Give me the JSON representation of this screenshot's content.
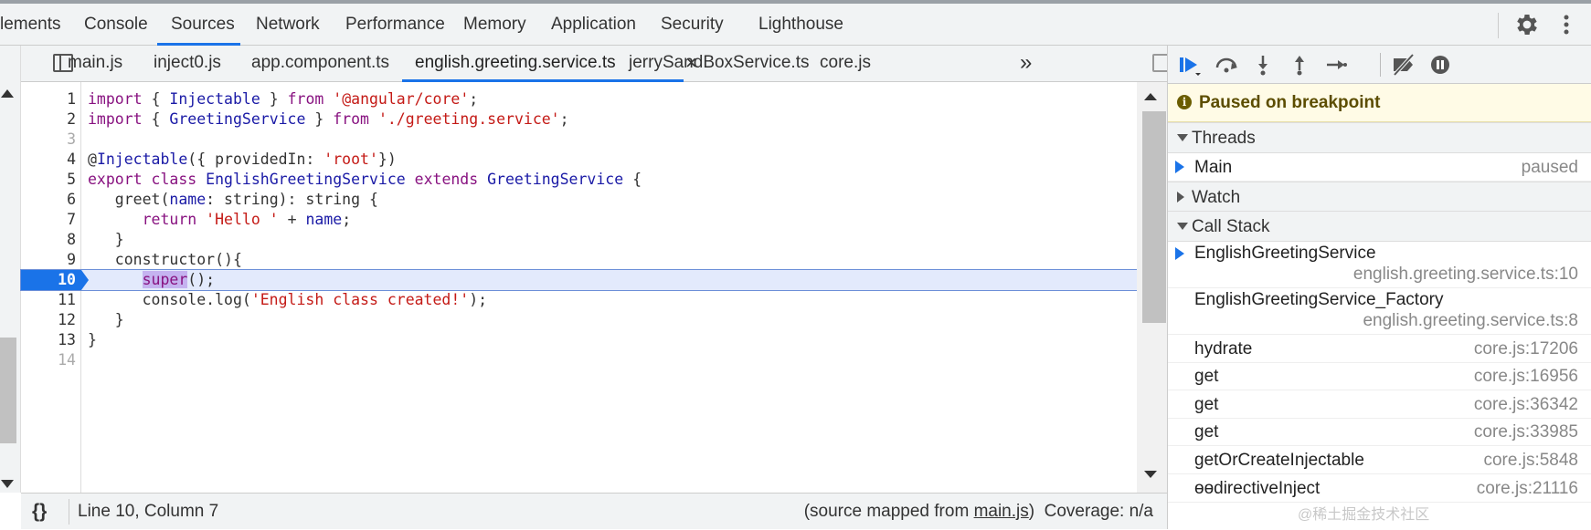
{
  "top_tabs": [
    "lements",
    "Console",
    "Sources",
    "Network",
    "Performance",
    "Memory",
    "Application",
    "Security",
    "Lighthouse"
  ],
  "file_tabs": [
    "main.js",
    "inject0.js",
    "app.component.ts",
    "english.greeting.service.ts",
    "jerrySandBoxService.ts",
    "core.js"
  ],
  "file_tab_close": "×",
  "overflow_chevron": "»",
  "code_lines": [
    {
      "n": "1",
      "code": "import { Injectable } from '@angular/core';"
    },
    {
      "n": "2",
      "code": "import { GreetingService } from './greeting.service';"
    },
    {
      "n": "3",
      "code": ""
    },
    {
      "n": "4",
      "code": "@Injectable({ providedIn: 'root'})"
    },
    {
      "n": "5",
      "code": "export class EnglishGreetingService extends GreetingService {"
    },
    {
      "n": "6",
      "code": "   greet(name: string): string {"
    },
    {
      "n": "7",
      "code": "      return 'Hello ' + name;"
    },
    {
      "n": "8",
      "code": "   }"
    },
    {
      "n": "9",
      "code": "   constructor(){"
    },
    {
      "n": "10",
      "code": "      super();"
    },
    {
      "n": "11",
      "code": "      console.log('English class created!');"
    },
    {
      "n": "12",
      "code": "   }"
    },
    {
      "n": "13",
      "code": "}"
    },
    {
      "n": "14",
      "code": ""
    }
  ],
  "status": {
    "braces": "{}",
    "position": "Line 10, Column 7",
    "mapped_prefix": "(source mapped from ",
    "mapped_file": "main.js",
    "mapped_suffix": ")",
    "coverage": "Coverage: n/a"
  },
  "debugger": {
    "paused_text": "Paused on breakpoint",
    "info_icon": "i",
    "threads_label": "Threads",
    "thread_name": "Main",
    "thread_state": "paused",
    "watch_label": "Watch",
    "callstack_label": "Call Stack",
    "frames": [
      {
        "name": "EnglishGreetingService",
        "loc": "english.greeting.service.ts:10"
      },
      {
        "name": "EnglishGreetingService_Factory",
        "loc": "english.greeting.service.ts:8"
      },
      {
        "name": "hydrate",
        "loc": "core.js:17206"
      },
      {
        "name": "get",
        "loc": "core.js:16956"
      },
      {
        "name": "get",
        "loc": "core.js:36342"
      },
      {
        "name": "get",
        "loc": "core.js:33985"
      },
      {
        "name": "getOrCreateInjectable",
        "loc": "core.js:5848"
      },
      {
        "name": "ɵɵdirectiveInject",
        "loc": "core.js:21116"
      }
    ]
  },
  "watermark": "@稀土掘金技术社区",
  "colors": {
    "accent": "#1a73e8",
    "paused_bg": "#fffbe6",
    "exec_line_bg": "#e3eafc"
  }
}
